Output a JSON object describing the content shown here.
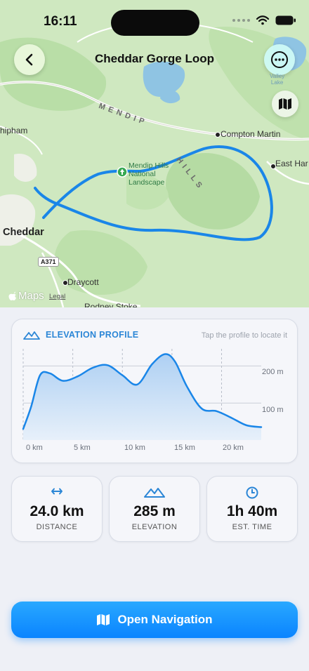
{
  "status_bar": {
    "time": "16:11"
  },
  "header": {
    "title": "Cheddar Gorge Loop"
  },
  "map": {
    "labels": {
      "cheddar": "Cheddar",
      "shipham": "hipham",
      "compton_martin": "Compton Martin",
      "east_harptree": "East Har",
      "draycott": "Draycott",
      "rodney_stoke": "Rodney Stoke",
      "mendip_line1": "Mendip Hills",
      "mendip_line2": "National",
      "mendip_line3": "Landscape",
      "ridge_mendip": "M E N D I P",
      "ridge_hills": "H I L L S",
      "lake_line1": "Valley",
      "lake_line2": "Lake",
      "road": "A371",
      "maps_brand": "Maps",
      "legal": "Legal"
    },
    "route_color": "#1a86e8"
  },
  "elevation": {
    "title": "ELEVATION PROFILE",
    "hint": "Tap the profile to locate it",
    "y_ticks": [
      "200 m",
      "100 m"
    ],
    "x_ticks": [
      "0 km",
      "5 km",
      "10 km",
      "15 km",
      "20 km"
    ]
  },
  "chart_data": {
    "type": "area",
    "title": "ELEVATION PROFILE",
    "xlabel": "",
    "ylabel": "",
    "x": [
      0,
      0.8,
      1.7,
      2.7,
      4,
      5.5,
      7,
      8.5,
      10,
      11.5,
      13,
      14.3,
      15.3,
      16.5,
      18,
      19.5,
      21,
      22.5,
      24
    ],
    "y": [
      30,
      90,
      175,
      180,
      160,
      172,
      195,
      202,
      175,
      150,
      205,
      232,
      212,
      145,
      85,
      78,
      60,
      40,
      35
    ],
    "xlim": [
      0,
      24
    ],
    "ylim": [
      0,
      250
    ],
    "grid": true
  },
  "stats": [
    {
      "icon": "arrows-left-right-icon",
      "value": "24.0 km",
      "label": "DISTANCE"
    },
    {
      "icon": "mountain-icon",
      "value": "285 m",
      "label": "ELEVATION"
    },
    {
      "icon": "clock-icon",
      "value": "1h 40m",
      "label": "EST. TIME"
    }
  ],
  "navigation": {
    "label": "Open Navigation"
  },
  "colors": {
    "accent": "#0a84ff",
    "map_green": "#cfe8c0",
    "chart_fill": "#cfe3f7"
  }
}
